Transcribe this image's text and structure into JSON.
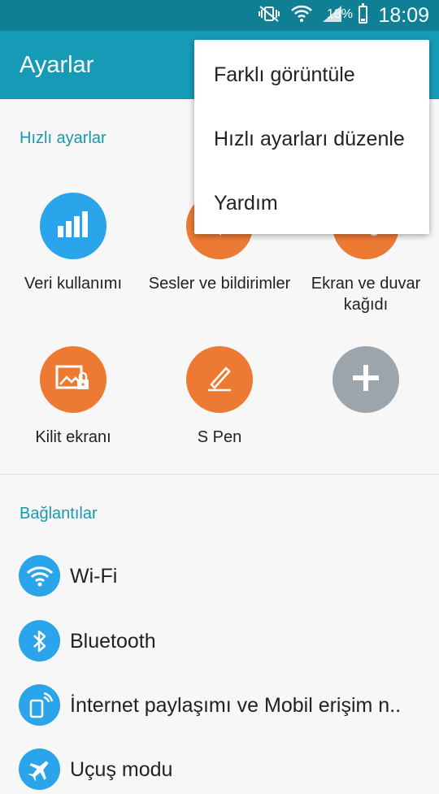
{
  "status_bar": {
    "battery_text": "18%",
    "battery_level": 0.18,
    "time": "18:09",
    "icons": [
      "silent-vibrate-icon",
      "wifi-icon",
      "signal-icon",
      "battery-icon"
    ]
  },
  "app_bar": {
    "title": "Ayarlar"
  },
  "quick_settings": {
    "title": "Hızlı ayarlar",
    "items": [
      {
        "label": "Veri kullanımı",
        "icon": "data-usage-icon",
        "color": "#2aa4ea"
      },
      {
        "label": "Sesler ve bildirimler",
        "icon": "sound-icon",
        "color": "#ec7a33"
      },
      {
        "label": "Ekran ve duvar kağıdı",
        "icon": "display-icon",
        "color": "#ec7a33"
      },
      {
        "label": "Kilit ekranı",
        "icon": "lock-screen-icon",
        "color": "#ec7a33"
      },
      {
        "label": "S Pen",
        "icon": "pen-icon",
        "color": "#ec7a33"
      },
      {
        "label": "",
        "icon": "add-icon",
        "color": "#9ca5ac"
      }
    ]
  },
  "connections": {
    "title": "Bağlantılar",
    "items": [
      {
        "label": "Wi-Fi",
        "icon": "wifi-icon"
      },
      {
        "label": "Bluetooth",
        "icon": "bluetooth-icon"
      },
      {
        "label": "İnternet paylaşımı ve Mobil erişim n..",
        "icon": "tethering-icon"
      },
      {
        "label": "Uçuş modu",
        "icon": "airplane-icon"
      }
    ]
  },
  "overflow_menu": {
    "items": [
      {
        "label": "Farklı görüntüle"
      },
      {
        "label": "Hızlı ayarları düzenle"
      },
      {
        "label": "Yardım"
      }
    ]
  },
  "colors": {
    "status_bar": "#0f7f96",
    "app_bar": "#169bb7",
    "accent_text": "#1998b1",
    "orange": "#ec7a33",
    "blue": "#2aa4ea",
    "gray": "#9ca5ac"
  }
}
